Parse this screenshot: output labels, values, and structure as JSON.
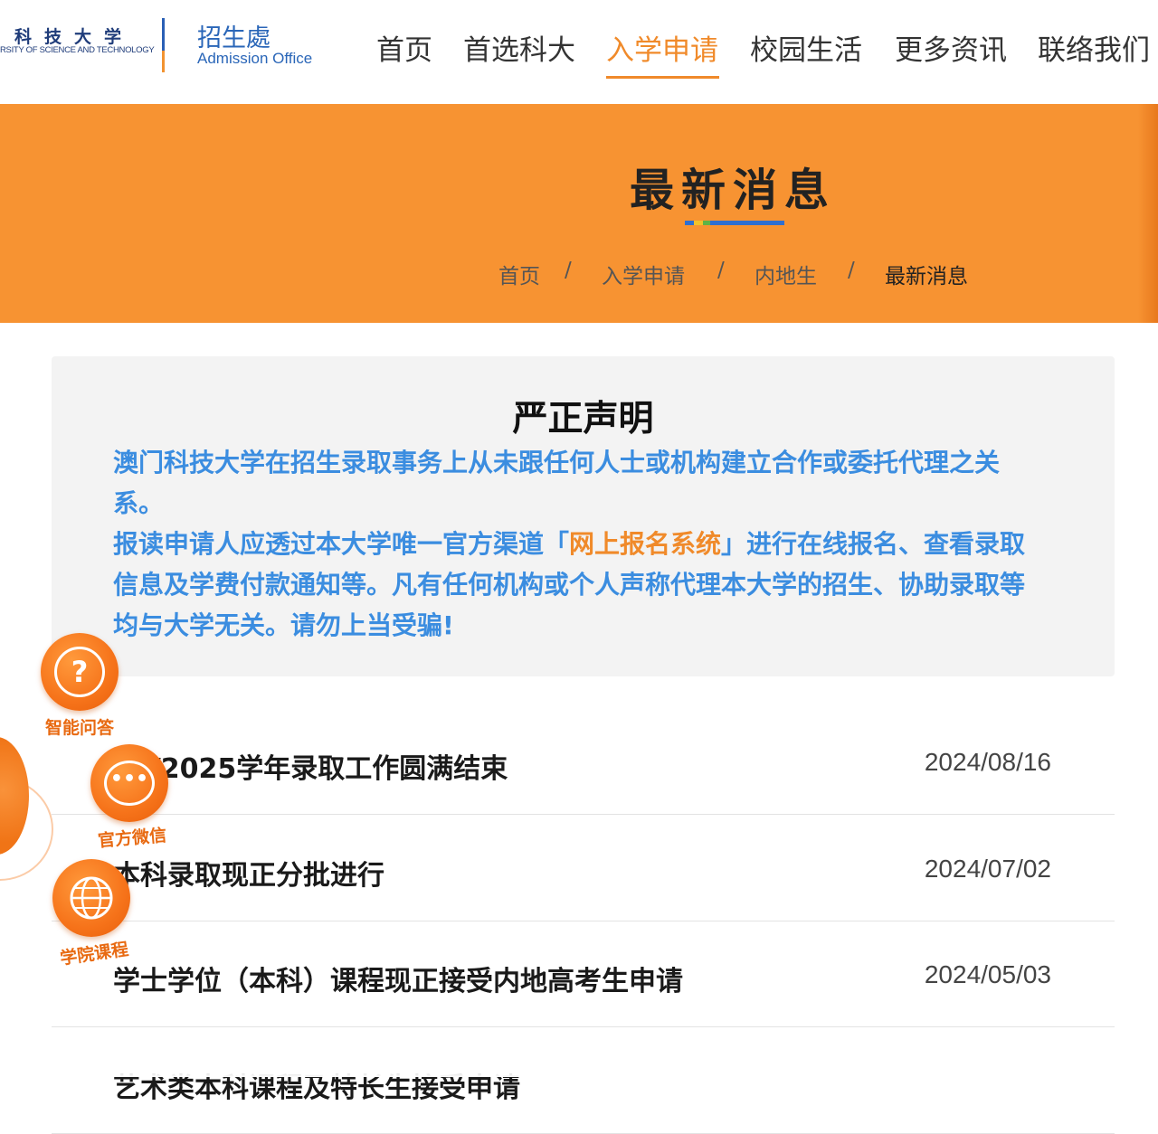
{
  "header": {
    "logo_cn": "科技大学",
    "logo_en": "RSITY OF SCIENCE AND TECHNOLOGY",
    "office_cn": "招生處",
    "office_en": "Admission Office",
    "nav": [
      "首页",
      "首选科大",
      "入学申请",
      "校园生活",
      "更多资讯",
      "联络我们"
    ],
    "active_nav": "入学申请"
  },
  "banner": {
    "title": "最新消息",
    "bar_colors": [
      "#2f6fd0",
      "#f2c22a",
      "#5fb347",
      "#2f6fd0"
    ],
    "breadcrumb": [
      "首页",
      "入学申请",
      "内地生",
      "最新消息"
    ],
    "separator": "/"
  },
  "notice": {
    "title": "严正声明",
    "para1": "澳门科技大学在招生录取事务上从未跟任何人士或机构建立合作或委托代理之关系。",
    "para2_before": "报读申请人应透过本大学唯一官方渠道「",
    "para2_link": "网上报名系统",
    "para2_after": "」进行在线报名、查看录取信息及学费付款通知等。凡有任何机构或个人声称代理本大学的招生、协助录取等均与大学无关。请勿上当受骗!"
  },
  "news": [
    {
      "title": "24/2025学年录取工作圆满结束",
      "date": "2024/08/16"
    },
    {
      "title": "本科录取现正分批进行",
      "date": "2024/07/02"
    },
    {
      "title": "学士学位（本科）课程现正接受内地高考生申请",
      "date": "2024/05/03"
    },
    {
      "title": "艺术类本科课程及特长生接受申请",
      "date": ""
    }
  ],
  "widgets": [
    {
      "label": "智能问答",
      "icon": "question-icon"
    },
    {
      "label": "官方微信",
      "icon": "chat-icon"
    },
    {
      "label": "学院课程",
      "icon": "globe-icon"
    }
  ],
  "colors": {
    "accent": "#f08a2a",
    "banner": "#f79332",
    "notice_text": "#3b8de0",
    "brand_blue": "#2a66b8"
  }
}
